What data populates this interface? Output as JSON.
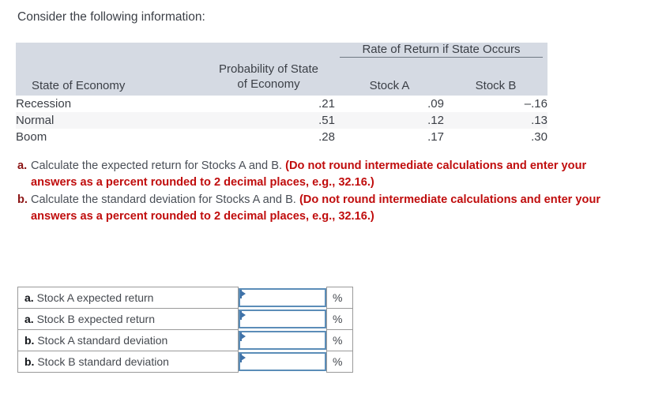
{
  "intro": "Consider the following information:",
  "data_table": {
    "group_header": "Rate of Return if State Occurs",
    "columns": {
      "state": "State of Economy",
      "probability_line1": "Probability of State",
      "probability_line2": "of Economy",
      "stock_a": "Stock A",
      "stock_b": "Stock B"
    },
    "rows": [
      {
        "state": "Recession",
        "probability": ".21",
        "stock_a": ".09",
        "stock_b": "–.16"
      },
      {
        "state": "Normal",
        "probability": ".51",
        "stock_a": ".12",
        "stock_b": ".13"
      },
      {
        "state": "Boom",
        "probability": ".28",
        "stock_a": ".17",
        "stock_b": ".30"
      }
    ]
  },
  "questions": [
    {
      "marker": "a.",
      "text": "Calculate the expected return for Stocks A and B.",
      "emphasis": "(Do not round intermediate calculations and enter your answers as a percent rounded to 2 decimal places, e.g., 32.16.)"
    },
    {
      "marker": "b.",
      "text": "Calculate the standard deviation for Stocks A and B.",
      "emphasis": "(Do not round intermediate calculations and enter your answers as a percent rounded to 2 decimal places, e.g., 32.16.)"
    }
  ],
  "answer_table": {
    "percent_symbol": "%",
    "rows": [
      {
        "marker": "a.",
        "label": "Stock A expected return",
        "value": "",
        "placeholder": ""
      },
      {
        "marker": "a.",
        "label": "Stock B expected return",
        "value": "",
        "placeholder": ""
      },
      {
        "marker": "b.",
        "label": "Stock A standard deviation",
        "value": "",
        "placeholder": ""
      },
      {
        "marker": "b.",
        "label": "Stock B standard deviation",
        "value": "",
        "placeholder": ""
      }
    ]
  },
  "colors": {
    "header_bg": "#d5dae3",
    "alt_row_bg": "#f6f6f7",
    "emphasis_red": "#c00d0d",
    "marker_red": "#8c1515",
    "input_border": "#5b8db8",
    "flag_blue": "#3f72a8"
  }
}
